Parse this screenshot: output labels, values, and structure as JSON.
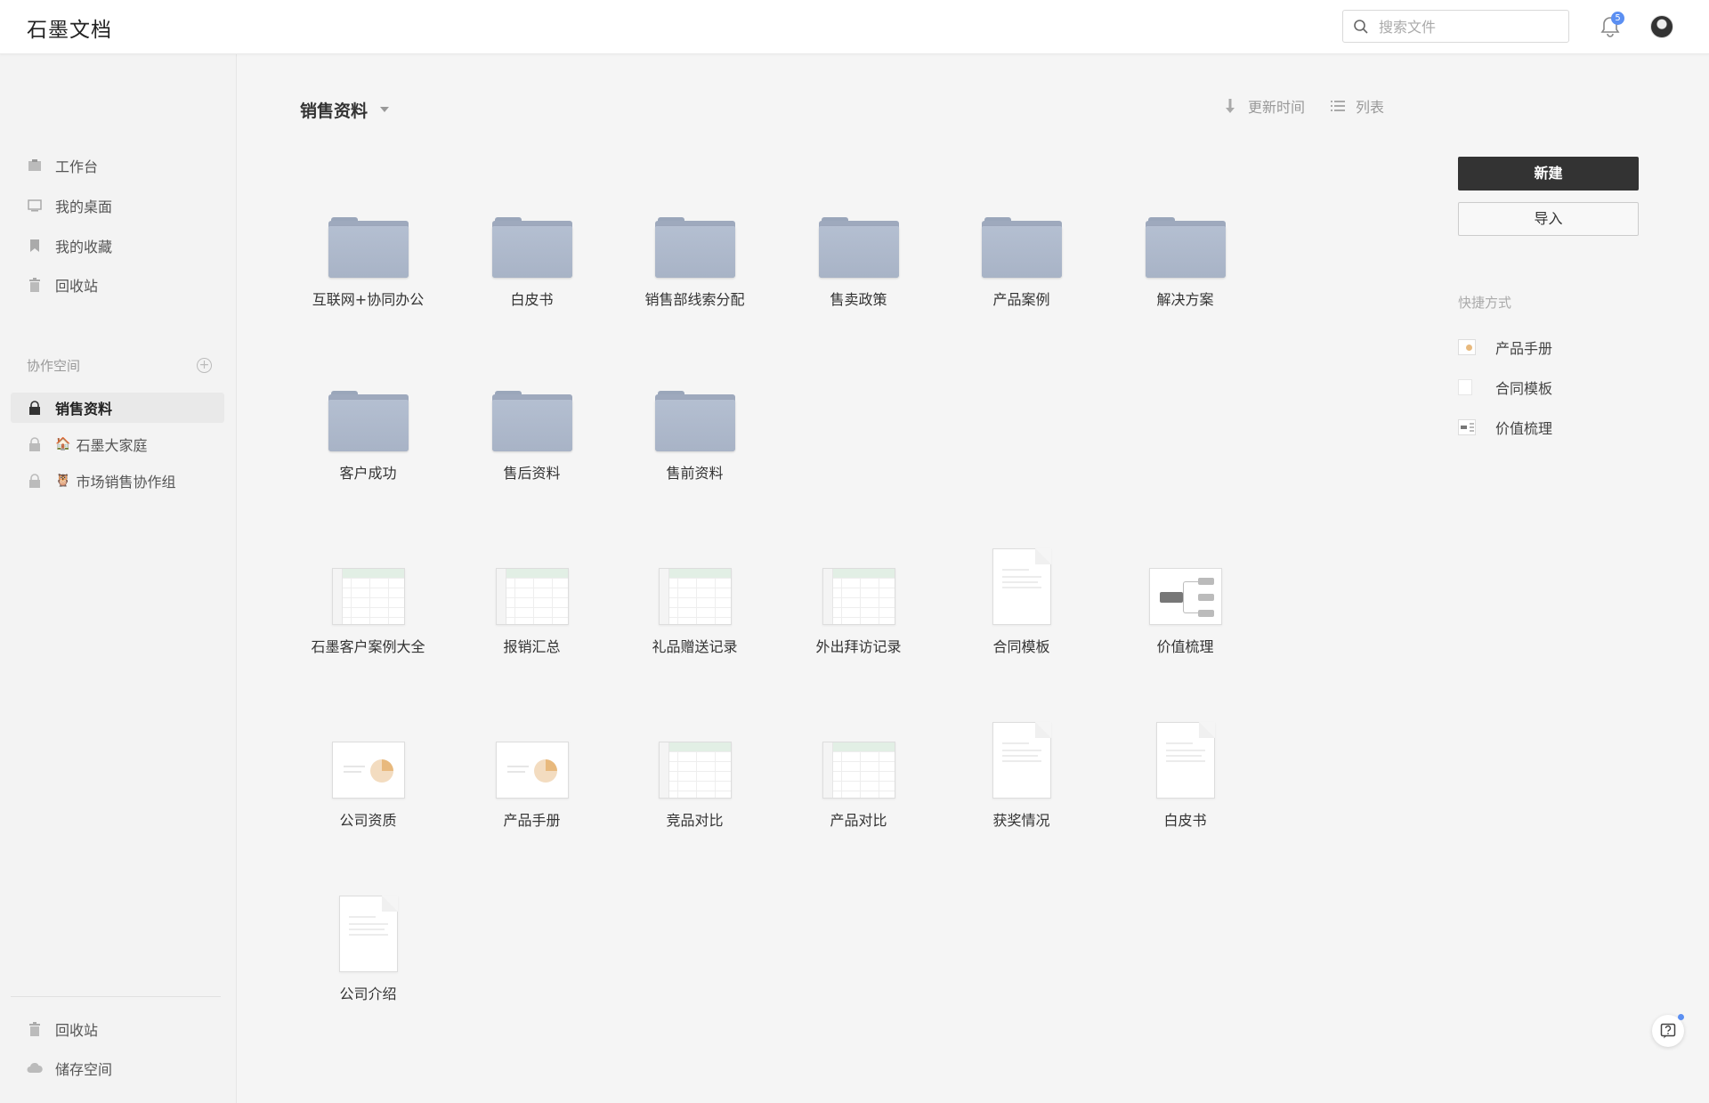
{
  "app": {
    "logo": "石墨文档"
  },
  "header": {
    "search_placeholder": "搜索文件",
    "notification_count": "5"
  },
  "sidebar": {
    "items": [
      {
        "label": "工作台",
        "icon": "workbench-icon"
      },
      {
        "label": "我的桌面",
        "icon": "desktop-icon"
      },
      {
        "label": "我的收藏",
        "icon": "bookmark-icon"
      },
      {
        "label": "回收站",
        "icon": "trash-icon"
      }
    ],
    "section_title": "协作空间",
    "spaces": [
      {
        "label": "销售资料",
        "icon": "lock-icon",
        "emoji": "",
        "active": true
      },
      {
        "label": "石墨大家庭",
        "icon": "lock-icon",
        "emoji": "🏠",
        "active": false
      },
      {
        "label": "市场销售协作组",
        "icon": "lock-icon",
        "emoji": "🦉",
        "active": false
      }
    ],
    "bottom": [
      {
        "label": "回收站",
        "icon": "trash-icon"
      },
      {
        "label": "储存空间",
        "icon": "cloud-icon"
      }
    ]
  },
  "main": {
    "folder_title": "销售资料",
    "sort_label": "更新时间",
    "view_label": "列表",
    "folders": [
      "互联网+协同办公",
      "白皮书",
      "销售部线索分配",
      "售卖政策",
      "产品案例",
      "解决方案",
      "客户成功",
      "售后资料",
      "售前资料"
    ],
    "files": [
      {
        "name": "石墨客户案例大全",
        "type": "sheet"
      },
      {
        "name": "报销汇总",
        "type": "sheet"
      },
      {
        "name": "礼品赠送记录",
        "type": "sheet"
      },
      {
        "name": "外出拜访记录",
        "type": "sheet"
      },
      {
        "name": "合同模板",
        "type": "doc"
      },
      {
        "name": "价值梳理",
        "type": "mindmap"
      },
      {
        "name": "公司资质",
        "type": "slide"
      },
      {
        "name": "产品手册",
        "type": "slide"
      },
      {
        "name": "竞品对比",
        "type": "sheet"
      },
      {
        "name": "产品对比",
        "type": "sheet"
      },
      {
        "name": "获奖情况",
        "type": "doc"
      },
      {
        "name": "白皮书",
        "type": "doc"
      },
      {
        "name": "公司介绍",
        "type": "doc"
      }
    ]
  },
  "right_panel": {
    "new_label": "新建",
    "import_label": "导入",
    "shortcuts_title": "快捷方式",
    "shortcuts": [
      {
        "label": "产品手册",
        "type": "slide"
      },
      {
        "label": "合同模板",
        "type": "doc"
      },
      {
        "label": "价值梳理",
        "type": "mindmap"
      }
    ]
  },
  "colors": {
    "primary_button": "#333333",
    "accent": "#5b8ff2",
    "folder": "#a8b3c6"
  }
}
